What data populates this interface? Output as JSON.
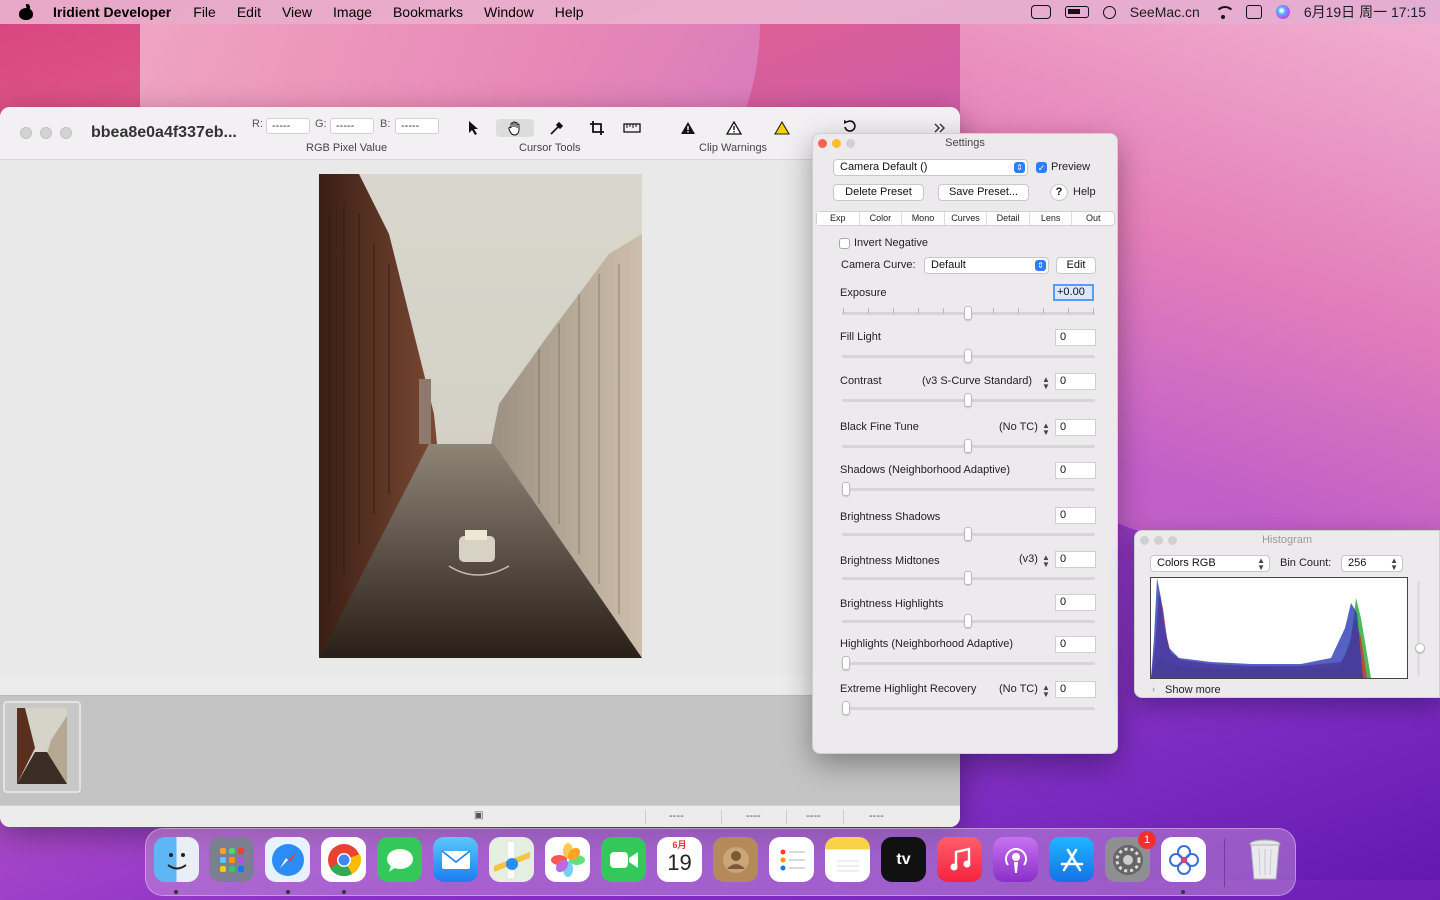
{
  "menubar": {
    "app_name": "Iridient Developer",
    "items": [
      "File",
      "Edit",
      "View",
      "Image",
      "Bookmarks",
      "Window",
      "Help"
    ],
    "right": {
      "host": "SeeMac.cn",
      "datetime": "6月19日 周一  17:15"
    }
  },
  "window": {
    "title": "bbea8e0a4f337eb...",
    "rgb": {
      "r_label": "R:",
      "g_label": "G:",
      "b_label": "B:",
      "r_value": "-----",
      "g_value": "-----",
      "b_value": "-----",
      "group_label": "RGB Pixel Value"
    },
    "cursor_tools_label": "Cursor Tools",
    "clip_warnings_label": "Clip Warnings",
    "status": [
      "----",
      "----",
      "----",
      "----"
    ]
  },
  "settings": {
    "title": "Settings",
    "preset": "Camera Default ()",
    "preview_label": "Preview",
    "delete_preset": "Delete Preset",
    "save_preset": "Save Preset...",
    "help": "Help",
    "tabs": [
      "Exp",
      "Color",
      "Mono",
      "Curves",
      "Detail",
      "Lens",
      "Out"
    ],
    "invert_negative": "Invert Negative",
    "camera_curve_label": "Camera Curve:",
    "camera_curve_value": "Default",
    "edit": "Edit",
    "exposure": {
      "label": "Exposure",
      "value": "+0.00"
    },
    "fill_light": {
      "label": "Fill Light",
      "value": "0"
    },
    "contrast": {
      "label": "Contrast",
      "mode": "(v3 S-Curve Standard)",
      "value": "0"
    },
    "black_fine_tune": {
      "label": "Black Fine Tune",
      "mode": "(No TC)",
      "value": "0"
    },
    "shadows_na": {
      "label": "Shadows (Neighborhood Adaptive)",
      "value": "0"
    },
    "brightness_shadows": {
      "label": "Brightness Shadows",
      "value": "0"
    },
    "brightness_midtones": {
      "label": "Brightness Midtones",
      "mode": "(v3)",
      "value": "0"
    },
    "brightness_highlights": {
      "label": "Brightness Highlights",
      "value": "0"
    },
    "highlights_na": {
      "label": "Highlights (Neighborhood Adaptive)",
      "value": "0"
    },
    "extreme_highlight": {
      "label": "Extreme Highlight Recovery",
      "mode": "(No TC)",
      "value": "0"
    }
  },
  "histogram": {
    "title": "Histogram",
    "mode": "Colors RGB",
    "bin_count_label": "Bin Count:",
    "bin_count": "256",
    "show_more": "Show more"
  },
  "dock": {
    "calendar_month": "6月",
    "calendar_day": "19",
    "tv_label": "tv",
    "settings_badge": "1"
  }
}
